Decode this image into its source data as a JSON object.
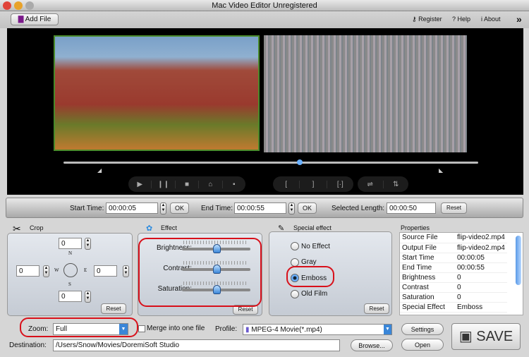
{
  "window": {
    "title": "Mac Video Editor Unregistered"
  },
  "toolbar": {
    "add_file": "Add File",
    "register": "Register",
    "help": "Help",
    "about": "About",
    "more": "»"
  },
  "player": {
    "position_percent": 57,
    "controls": [
      "▶",
      "❙❙",
      "■",
      "⌂",
      "▪"
    ],
    "trim_controls": [
      "[",
      "]",
      "[·]"
    ],
    "flip_controls": [
      "⇌",
      "⇅"
    ]
  },
  "timebar": {
    "start_label": "Start Time:",
    "start_value": "00:00:05",
    "end_label": "End Time:",
    "end_value": "00:00:55",
    "ok": "OK",
    "length_label": "Selected Length:",
    "length_value": "00:00:50",
    "reset": "Reset"
  },
  "crop": {
    "title": "Crop",
    "top": "0",
    "left": "0",
    "right": "0",
    "bottom": "0",
    "n": "N",
    "s": "S",
    "w": "W",
    "e": "E",
    "reset": "Reset"
  },
  "effect": {
    "title": "Effect",
    "sliders": [
      {
        "label": "Brightness:",
        "value": 0
      },
      {
        "label": "Contrast:",
        "value": 0
      },
      {
        "label": "Saturation:",
        "value": 0
      }
    ],
    "reset": "Reset"
  },
  "special": {
    "title": "Special effect",
    "options": [
      "No Effect",
      "Gray",
      "Emboss",
      "Old Film"
    ],
    "selected": "Emboss",
    "reset": "Reset"
  },
  "properties": {
    "title": "Properties",
    "rows": [
      [
        "Source File",
        "flip-video2.mp4"
      ],
      [
        "Output File",
        "flip-video2.mp4"
      ],
      [
        "Start Time",
        "00:00:05"
      ],
      [
        "End Time",
        "00:00:55"
      ],
      [
        "Brightness",
        "0"
      ],
      [
        "Contrast",
        "0"
      ],
      [
        "Saturation",
        "0"
      ],
      [
        "Special Effect",
        "Emboss"
      ]
    ]
  },
  "bottom": {
    "zoom_label": "Zoom:",
    "zoom_value": "Full",
    "merge_label": "Merge into one file",
    "profile_label": "Profile:",
    "profile_value": "MPEG-4 Movie(*.mp4)",
    "settings": "Settings",
    "destination_label": "Destination:",
    "destination_value": "/Users/Snow/Movies/DoremiSoft Studio",
    "browse": "Browse...",
    "open": "Open",
    "save": "SAVE"
  },
  "colors": {
    "accent": "#3a86d8",
    "annotation": "#d8101a"
  }
}
